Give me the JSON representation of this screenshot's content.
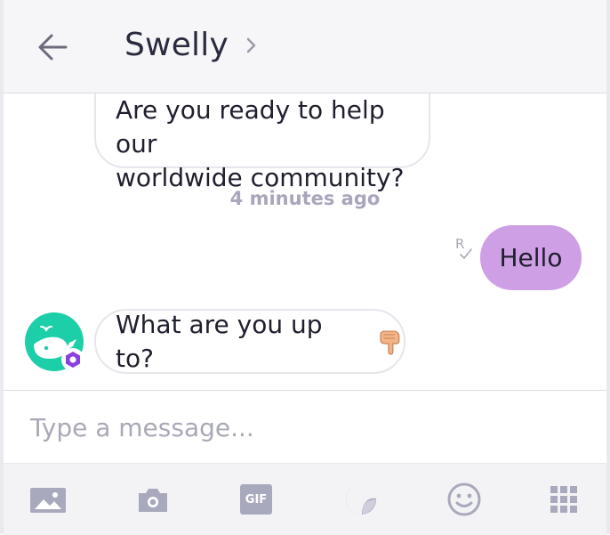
{
  "header": {
    "title": "Swelly",
    "back_icon": "arrow-left-icon",
    "details_icon": "chevron-right-icon"
  },
  "messages": {
    "incoming_top": {
      "line1": "Are you ready to help our",
      "line2": "worldwide community?"
    },
    "timestamp": "4 minutes ago",
    "outgoing": {
      "text": "Hello",
      "read_indicator": "R"
    },
    "incoming_bottom": {
      "text": "What are you up to?",
      "emoji": "backhand-index-pointing-down-emoji"
    }
  },
  "input": {
    "placeholder": "Type a message..."
  },
  "toolbar": {
    "gif_label": "GIF",
    "icons": [
      "gallery-icon",
      "camera-icon",
      "gif-icon",
      "sticker-icon",
      "emoji-icon",
      "more-grid-icon"
    ]
  },
  "colors": {
    "outgoing_bubble": "#cf9fe6",
    "avatar_bg": "#1dcfa8",
    "badge": "#8a3fe0",
    "icon_gray": "#a9a9bd",
    "title": "#2b2b3f"
  }
}
